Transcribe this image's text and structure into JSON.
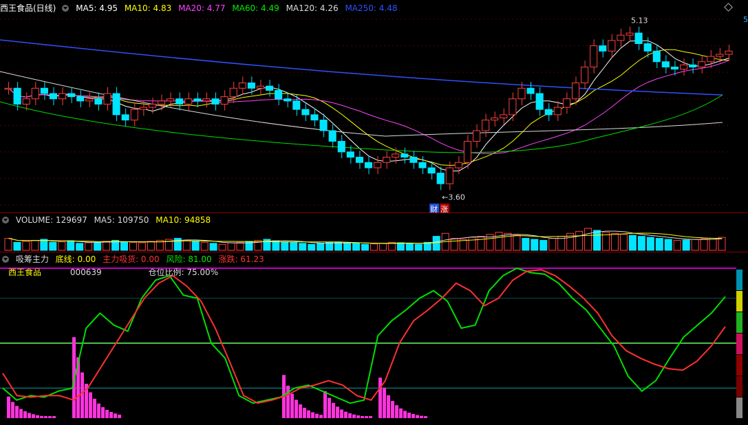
{
  "price_panel": {
    "title": "西王食品(日线)",
    "ma": [
      {
        "label": "MA5: 4.95",
        "color": "#ffffff"
      },
      {
        "label": "MA10: 4.83",
        "color": "#ffff00"
      },
      {
        "label": "MA20: 4.77",
        "color": "#ff44ff"
      },
      {
        "label": "MA60: 4.49",
        "color": "#00e000"
      },
      {
        "label": "MA120: 4.26",
        "color": "#dddddd"
      },
      {
        "label": "MA250: 4.48",
        "color": "#3050ff"
      }
    ],
    "high_label": "5.13",
    "low_label": "3.60",
    "badge_cai": "财",
    "badge_zhang": "涨",
    "edge_tag": "5"
  },
  "volume_panel": {
    "labels": [
      {
        "label": "VOLUME: 129697",
        "color": "#dddddd"
      },
      {
        "label": "MA5: 109750",
        "color": "#dddddd"
      },
      {
        "label": "MA10: 94858",
        "color": "#ffff00"
      }
    ]
  },
  "indicator_panel": {
    "title": "吸筹主力",
    "labels": [
      {
        "label": "底线: 0.00",
        "color": "#ffff00"
      },
      {
        "label": "主力吸货: 0.00",
        "color": "#ff3030"
      },
      {
        "label": "风险: 81.00",
        "color": "#00e000"
      },
      {
        "label": "涨跌: 61.23",
        "color": "#ff3030"
      }
    ],
    "stock_name": "西王食品",
    "stock_code": "000639",
    "position_ratio": "仓位比例: 75.00%"
  },
  "chart_data": [
    {
      "type": "candlestick",
      "title": "西王食品(日线)",
      "ylim": [
        3.5,
        5.25
      ],
      "series_names": [
        "MA5",
        "MA10",
        "MA20",
        "MA60",
        "MA120",
        "MA250"
      ],
      "close": [
        4.6,
        4.45,
        4.5,
        4.6,
        4.55,
        4.5,
        4.55,
        4.52,
        4.48,
        4.5,
        4.45,
        4.55,
        4.35,
        4.3,
        4.4,
        4.42,
        4.45,
        4.48,
        4.5,
        4.45,
        4.5,
        4.48,
        4.5,
        4.45,
        4.52,
        4.6,
        4.65,
        4.6,
        4.62,
        4.58,
        4.5,
        4.48,
        4.4,
        4.35,
        4.3,
        4.2,
        4.1,
        4.0,
        3.95,
        3.9,
        3.85,
        3.9,
        3.95,
        3.98,
        3.95,
        3.9,
        3.85,
        3.8,
        3.7,
        3.85,
        3.9,
        4.1,
        4.2,
        4.3,
        4.32,
        4.35,
        4.5,
        4.6,
        4.55,
        4.4,
        4.35,
        4.42,
        4.5,
        4.65,
        4.8,
        5.0,
        4.95,
        5.05,
        5.1,
        5.12,
        5.02,
        4.95,
        4.85,
        4.8,
        4.78,
        4.82,
        4.8,
        4.85,
        4.9,
        4.92,
        4.95
      ]
    },
    {
      "type": "bar",
      "title": "VOLUME",
      "values": [
        60,
        40,
        45,
        50,
        55,
        40,
        42,
        48,
        35,
        38,
        40,
        45,
        50,
        42,
        40,
        38,
        45,
        50,
        55,
        60,
        50,
        45,
        40,
        35,
        30,
        38,
        40,
        45,
        50,
        55,
        48,
        42,
        40,
        35,
        30,
        35,
        40,
        42,
        38,
        35,
        30,
        32,
        35,
        40,
        38,
        34,
        30,
        40,
        70,
        85,
        60,
        55,
        65,
        70,
        80,
        90,
        85,
        75,
        60,
        55,
        50,
        60,
        70,
        85,
        95,
        110,
        100,
        90,
        85,
        80,
        75,
        70,
        65,
        60,
        55,
        50,
        52,
        55,
        58,
        60,
        65
      ]
    },
    {
      "type": "line",
      "title": "吸筹主力",
      "ylim": [
        0,
        100
      ],
      "series": [
        {
          "name": "风险",
          "color": "#00e000",
          "values": [
            20,
            12,
            15,
            14,
            18,
            20,
            60,
            70,
            62,
            58,
            80,
            92,
            95,
            82,
            80,
            50,
            40,
            15,
            10,
            12,
            14,
            20,
            22,
            18,
            14,
            10,
            12,
            55,
            65,
            72,
            80,
            85,
            78,
            60,
            62,
            85,
            95,
            100,
            97,
            96,
            90,
            80,
            72,
            60,
            48,
            28,
            18,
            25,
            40,
            54,
            62,
            70,
            81
          ]
        },
        {
          "name": "涨跌",
          "color": "#ff3030",
          "values": [
            30,
            15,
            14,
            15,
            15,
            12,
            20,
            35,
            50,
            65,
            80,
            90,
            95,
            88,
            78,
            60,
            38,
            15,
            10,
            12,
            15,
            20,
            22,
            25,
            22,
            15,
            12,
            25,
            50,
            65,
            72,
            80,
            90,
            85,
            75,
            80,
            92,
            98,
            99,
            95,
            88,
            80,
            70,
            55,
            45,
            40,
            36,
            33,
            32,
            38,
            48,
            61
          ]
        }
      ]
    }
  ]
}
